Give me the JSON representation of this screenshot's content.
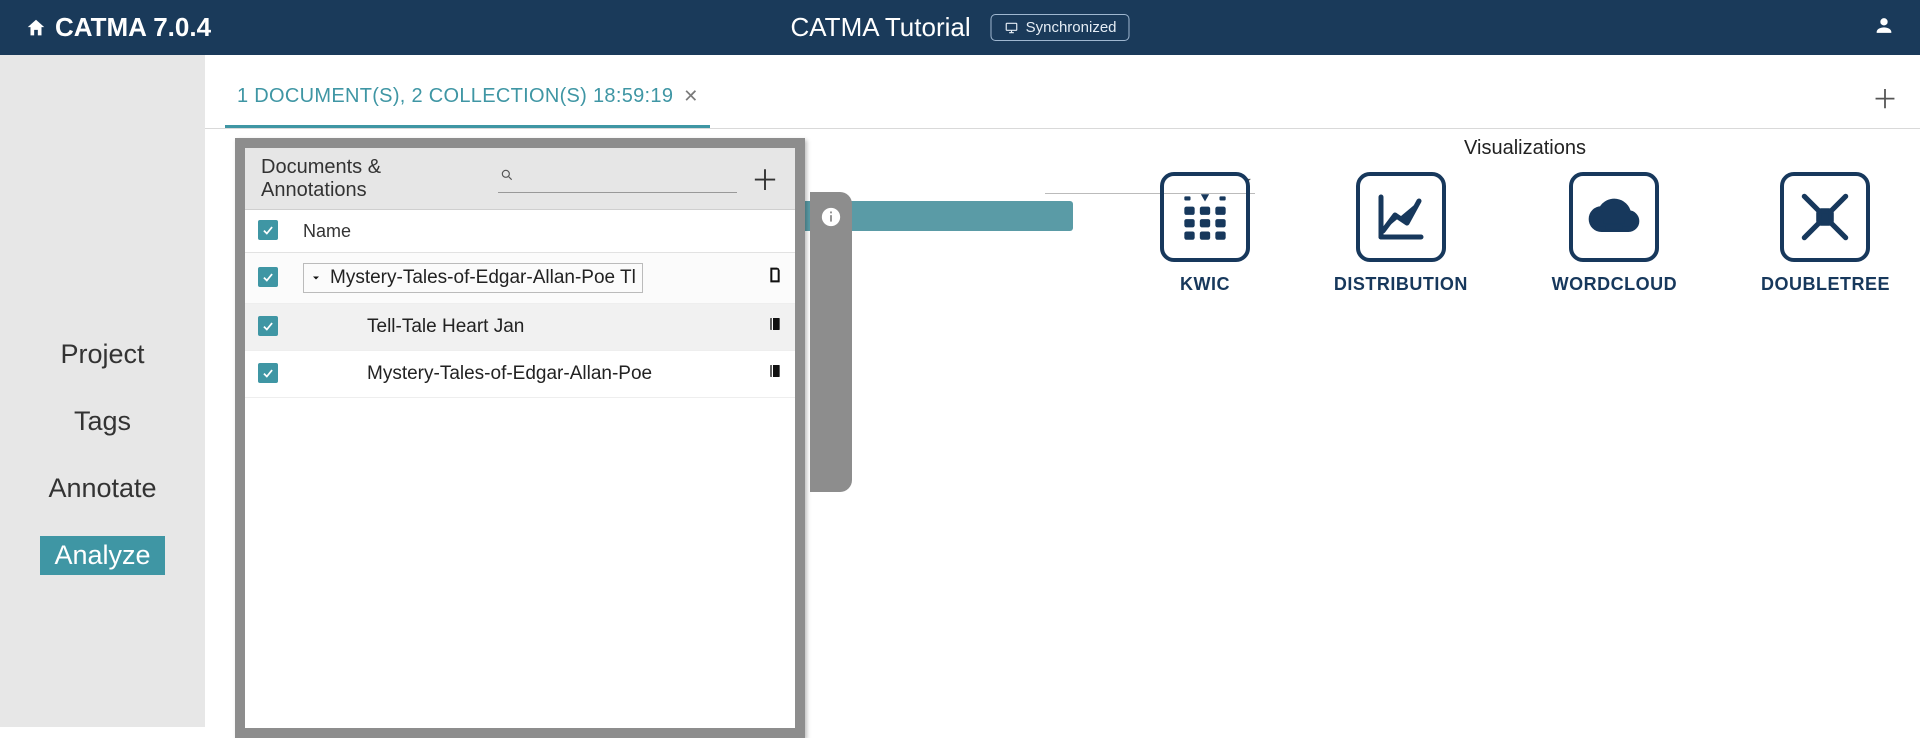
{
  "header": {
    "app_title": "CATMA 7.0.4",
    "project_name": "CATMA Tutorial",
    "sync_label": "Synchronized"
  },
  "sidebar": {
    "items": [
      {
        "label": "Project"
      },
      {
        "label": "Tags"
      },
      {
        "label": "Annotate"
      },
      {
        "label": "Analyze",
        "active": true
      }
    ]
  },
  "tabs": {
    "items": [
      {
        "label": "1 DOCUMENT(S), 2 COLLECTION(S) 18:59:19"
      }
    ]
  },
  "viz": {
    "title": "Visualizations",
    "cards": [
      {
        "label": "KWIC"
      },
      {
        "label": "DISTRIBUTION"
      },
      {
        "label": "WORDCLOUD"
      },
      {
        "label": "DOUBLETREE"
      }
    ]
  },
  "panel": {
    "title": "Documents & Annotations",
    "search_placeholder": "",
    "columns": {
      "name": "Name"
    },
    "rows": [
      {
        "name": "Mystery-Tales-of-Edgar-Allan-Poe Tl",
        "type": "document",
        "checked": true,
        "expanded": true
      },
      {
        "name": "Tell-Tale Heart Jan",
        "type": "collection",
        "checked": true
      },
      {
        "name": "Mystery-Tales-of-Edgar-Allan-Poe",
        "type": "collection",
        "checked": true
      }
    ]
  }
}
